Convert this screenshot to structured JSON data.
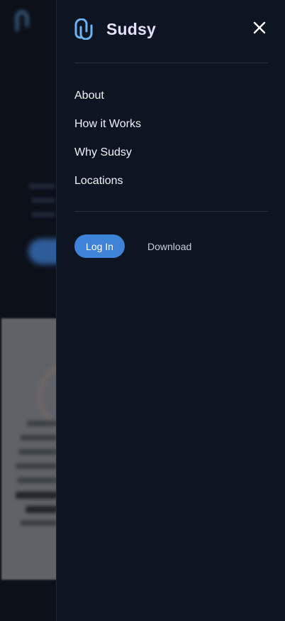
{
  "brand": {
    "name": "Sudsy",
    "icon": "sudsy-logo-icon",
    "accent": "#6fb3f2"
  },
  "nav": [
    {
      "label": "About"
    },
    {
      "label": "How it Works"
    },
    {
      "label": "Why Sudsy"
    },
    {
      "label": "Locations"
    }
  ],
  "actions": {
    "login_label": "Log In",
    "download_label": "Download"
  },
  "colors": {
    "panel": "#0d1422",
    "primary_button": "#3f83d8",
    "text": "#f2f3f6"
  }
}
